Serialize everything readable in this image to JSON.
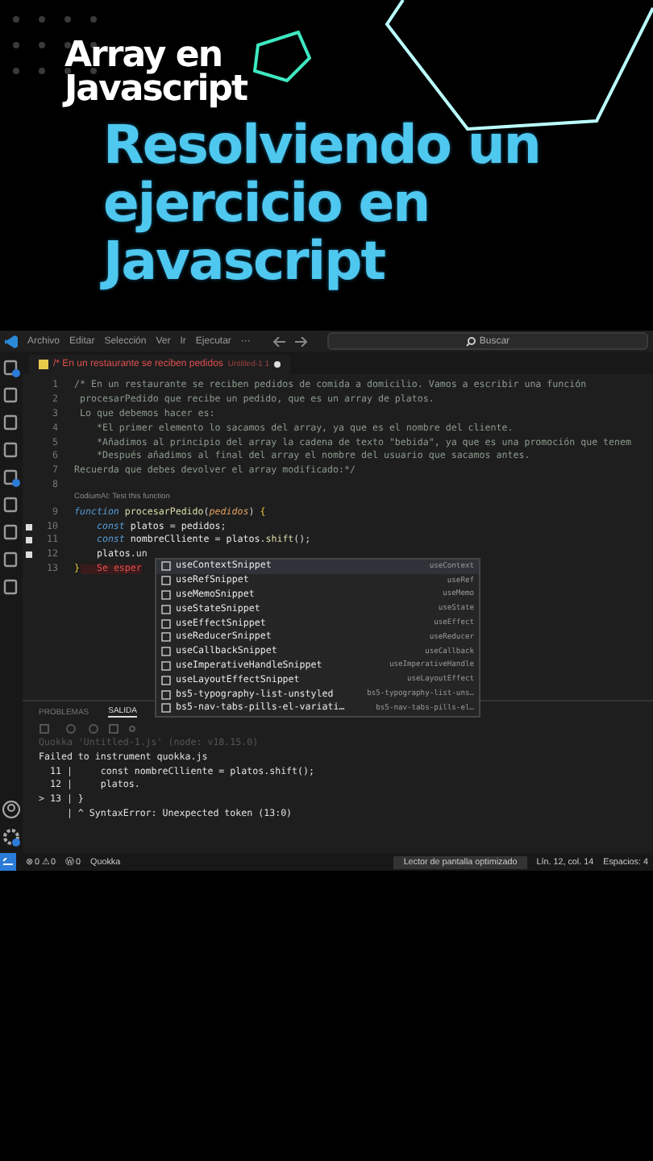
{
  "header": {
    "subtitle": [
      "Array en",
      "Javascript"
    ],
    "title": [
      "Resolviendo un",
      "ejercicio en",
      "Javascript"
    ]
  },
  "editor": {
    "menu": [
      "Archivo",
      "Editar",
      "Selección",
      "Ver",
      "Ir",
      "Ejecutar",
      "···"
    ],
    "search": {
      "placeholder": "Buscar"
    },
    "tab": {
      "title": "/* En un restaurante se reciben pedidos",
      "suffix": "Untitled-1 1",
      "modified": true
    },
    "lines": [
      {
        "n": "1",
        "marker": false,
        "parts": [
          {
            "kind": "comment",
            "t": "/* En un restaurante se reciben pedidos de comida a domicilio. Vamos a escribir una función"
          }
        ]
      },
      {
        "n": "2",
        "marker": false,
        "parts": [
          {
            "kind": "comment",
            "t": " procesarPedido que recibe un pedido, que es un array de platos."
          }
        ]
      },
      {
        "n": "3",
        "marker": false,
        "parts": [
          {
            "kind": "comment",
            "t": " Lo que debemos hacer es:"
          }
        ]
      },
      {
        "n": "4",
        "marker": false,
        "parts": [
          {
            "kind": "comment",
            "t": "    *El primer elemento lo sacamos del array, ya que es el nombre del cliente."
          }
        ]
      },
      {
        "n": "5",
        "marker": false,
        "parts": [
          {
            "kind": "comment",
            "t": "    *Añadimos al principio del array la cadena de texto \"bebida\", ya que es una promoción que tenem"
          }
        ]
      },
      {
        "n": "6",
        "marker": false,
        "parts": [
          {
            "kind": "comment",
            "t": "    *Después añadimos al final del array el nombre del usuario que sacamos antes."
          }
        ]
      },
      {
        "n": "7",
        "marker": false,
        "parts": [
          {
            "kind": "comment",
            "t": "Recuerda que debes devolver el array modificado:*/"
          }
        ]
      },
      {
        "n": "8",
        "marker": false
      },
      {
        "lens": "CodiumAI: Test this function"
      },
      {
        "n": "9",
        "marker": false,
        "parts": [
          {
            "kind": "kw",
            "t": "function "
          },
          {
            "kind": "fn",
            "t": "procesarPedido"
          },
          {
            "kind": "punc",
            "t": "("
          },
          {
            "kind": "param",
            "t": "pedidos"
          },
          {
            "kind": "punc",
            "t": ") "
          },
          {
            "kind": "brace",
            "t": "{"
          }
        ]
      },
      {
        "n": "10",
        "marker": true,
        "parts": [
          {
            "kind": "kw",
            "t": "    const "
          },
          {
            "kind": "var",
            "t": "platos"
          },
          {
            "kind": "punc",
            "t": " = "
          },
          {
            "kind": "var",
            "t": "pedidos"
          },
          {
            "kind": "punc",
            "t": ";"
          }
        ]
      },
      {
        "n": "11",
        "marker": true,
        "parts": [
          {
            "kind": "kw",
            "t": "    const "
          },
          {
            "kind": "var",
            "t": "nombreClliente"
          },
          {
            "kind": "punc",
            "t": " = "
          },
          {
            "kind": "var",
            "t": "platos"
          },
          {
            "kind": "punc",
            "t": "."
          },
          {
            "kind": "fn",
            "t": "shift"
          },
          {
            "kind": "punc",
            "t": "();"
          }
        ]
      },
      {
        "n": "12",
        "marker": true,
        "parts": [
          {
            "kind": "var",
            "t": "    platos"
          },
          {
            "kind": "punc",
            "t": ".un"
          }
        ]
      },
      {
        "n": "13",
        "marker": false,
        "parts": [
          {
            "kind": "brace",
            "t": "}"
          },
          {
            "kind": "error",
            "t": "   Se esper"
          }
        ]
      }
    ],
    "suggestions": [
      {
        "label": "useContextSnippet",
        "detail": "useContext",
        "selected": true
      },
      {
        "label": "useRefSnippet",
        "detail": "useRef",
        "selected": false
      },
      {
        "label": "useMemoSnippet",
        "detail": "useMemo",
        "selected": false
      },
      {
        "label": "useStateSnippet",
        "detail": "useState",
        "selected": false
      },
      {
        "label": "useEffectSnippet",
        "detail": "useEffect",
        "selected": false
      },
      {
        "label": "useReducerSnippet",
        "detail": "useReducer",
        "selected": false
      },
      {
        "label": "useCallbackSnippet",
        "detail": "useCallback",
        "selected": false
      },
      {
        "label": "useImperativeHandleSnippet",
        "detail": "useImperativeHandle",
        "selected": false
      },
      {
        "label": "useLayoutEffectSnippet",
        "detail": "useLayoutEffect",
        "selected": false
      },
      {
        "label": "bs5-typography-list-unstyled",
        "detail": "bs5-typography-list-uns…",
        "selected": false
      },
      {
        "label": "bs5-nav-tabs-pills-el-variati…",
        "detail": "bs5-nav-tabs-pills-el…",
        "selected": false
      }
    ]
  },
  "panel": {
    "tabs": [
      {
        "label": "PROBLEMAS",
        "selected": false
      },
      {
        "label": "SALIDA",
        "selected": true
      }
    ],
    "output": [
      {
        "kind": "info",
        "text": "Quokka 'Untitled-1.js' (node: v18.15.0)"
      },
      {
        "kind": "plain",
        "text": "Failed to instrument quokka.js"
      },
      {
        "kind": "plain",
        "text": "  11 |     const nombreClliente = platos.shift();"
      },
      {
        "kind": "plain",
        "text": "  12 |     platos."
      },
      {
        "kind": "plain",
        "text": "> 13 | }"
      },
      {
        "kind": "plain",
        "text": "     | ^ SyntaxError: Unexpected token (13:0)"
      }
    ]
  },
  "status_bar": {
    "left": [
      "⊗ 0 ⚠ 0",
      "Ⓦ 0",
      "Quokka"
    ],
    "right": [
      "Lector de pantalla optimizado",
      "Lín. 12, col. 14",
      "Espacios: 4"
    ]
  }
}
